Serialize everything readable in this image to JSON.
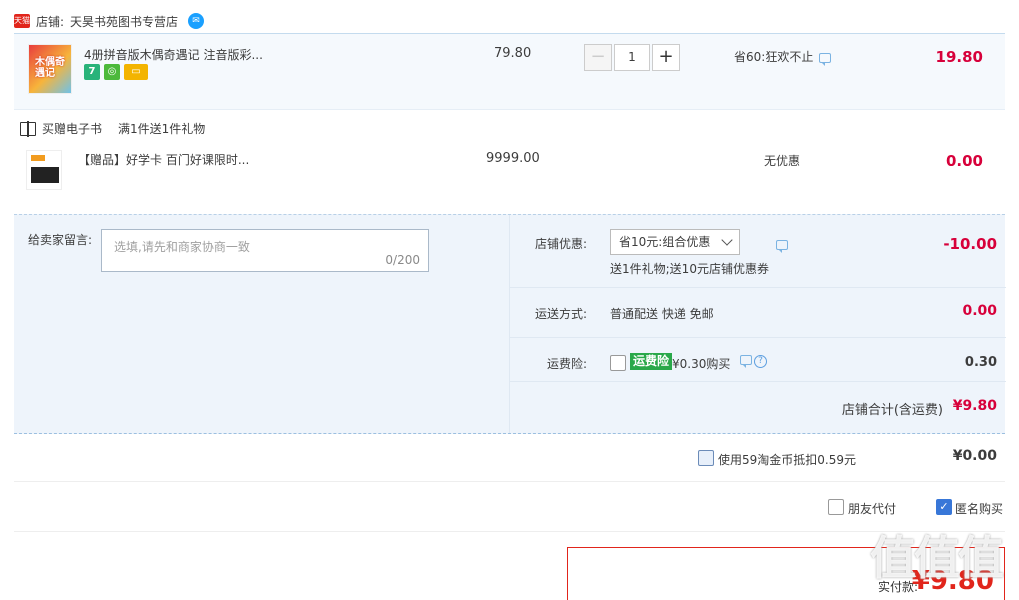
{
  "shop": {
    "label": "店铺:",
    "name": "天昊书苑图书专营店",
    "tmall_logo": "天猫"
  },
  "item": {
    "title": "4册拼音版木偶奇遇记 注音版彩...",
    "thumb_text": "木偶奇遇记",
    "badges": [
      "7",
      "",
      ""
    ],
    "price": "79.80",
    "quantity": "1",
    "minus": "−",
    "plus": "+",
    "discount_note": "省60:狂欢不止",
    "subtotal": "19.80"
  },
  "gift": {
    "header_label": "买赠电子书",
    "header_promo": "满1件送1件礼物",
    "title": "【赠品】好学卡 百门好课限时...",
    "price": "9999.00",
    "discount_text": "无优惠",
    "subtotal": "0.00"
  },
  "order": {
    "message_label": "给卖家留言:",
    "message_placeholder": "选填,请先和商家协商一致",
    "message_count": "0/200",
    "shop_discount_label": "店铺优惠:",
    "shop_discount_value": "省10元:组合优惠",
    "shop_discount_note": "送1件礼物;送10元店铺优惠券",
    "shop_discount_amount": "-10.00",
    "shipping_label": "运送方式:",
    "shipping_value": "普通配送 快递 免邮",
    "shipping_amount": "0.00",
    "insurance_label": "运费险:",
    "insurance_badge": "运费险",
    "insurance_text": "¥0.30购买",
    "insurance_amount": "0.30",
    "total_label": "店铺合计(含运费)",
    "total_amount": "¥9.80"
  },
  "coins": {
    "text": "使用59淘金币抵扣0.59元",
    "amount": "¥0.00"
  },
  "payment": {
    "friend_pay_label": "朋友代付",
    "anonymous_label": "匿名购买",
    "pay_label": "实付款:",
    "pay_amount": "¥9.80"
  },
  "watermark": "值值值"
}
